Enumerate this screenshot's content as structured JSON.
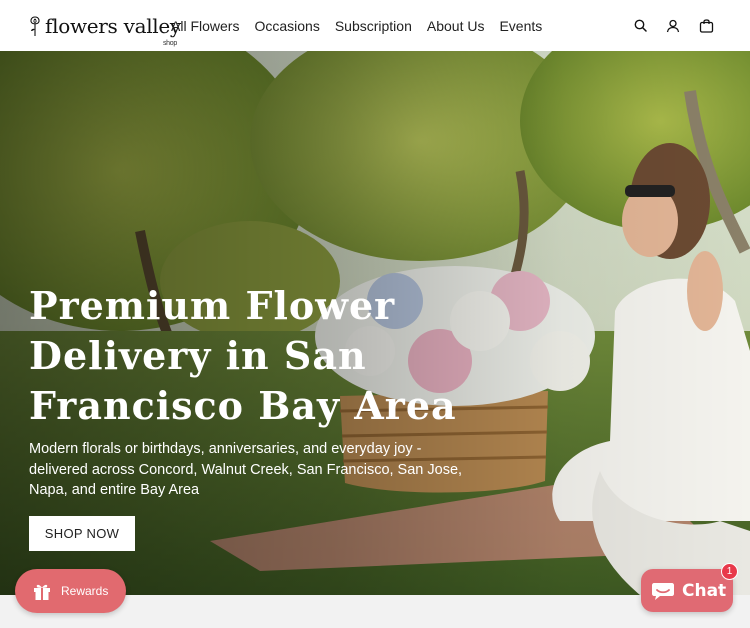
{
  "brand": {
    "name": "flowers valley",
    "tag": "shop"
  },
  "nav": {
    "items": [
      "All Flowers",
      "Occasions",
      "Subscription",
      "About Us",
      "Events"
    ]
  },
  "header_icons": [
    "search-icon",
    "account-icon",
    "cart-icon"
  ],
  "hero": {
    "title_lines": [
      "Premium Flower",
      "Delivery in San",
      "Francisco Bay Area"
    ],
    "subtitle_lines": [
      "Modern florals or birthdays, anniversaries, and everyday joy -",
      "delivered across Concord, Walnut Creek, San Francisco, San Jose,",
      "Napa, and entire Bay Area"
    ],
    "cta_label": "SHOP NOW"
  },
  "rewards": {
    "label": "Rewards",
    "icon": "gift-icon"
  },
  "chat": {
    "label": "Chat",
    "icon": "chat-bubble-icon",
    "badge_count": "1"
  },
  "colors": {
    "header_bg": "#ffffff",
    "rewards_bg": "#e16a6f",
    "chat_bg": "#e06a73",
    "badge_bg": "#e8394a",
    "footer_strip": "#f2f2f2"
  }
}
